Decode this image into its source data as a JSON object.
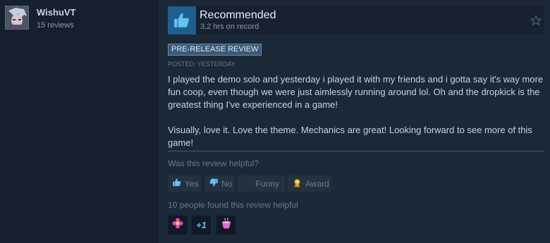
{
  "user": {
    "name": "WishuVT",
    "reviews": "15 reviews"
  },
  "review": {
    "verdict": "Recommended",
    "hours": "3,2 hrs on record",
    "badge": "PRE-RELEASE REVIEW",
    "posted": "POSTED: YESTERDAY",
    "paragraphs": [
      "I played the demo solo and yesterday i played it with my friends and i gotta say it's way more fun coop, even though we were just aimlessly running around lol. Oh and the dropkick is the greatest thing I've experienced in a game!",
      "Visually, love it. Love the theme. Mechanics are great! Looking forward to see more of this game!"
    ]
  },
  "feedback": {
    "question": "Was this review helpful?",
    "yes_label": "Yes",
    "no_label": "No",
    "funny_label": "Funny",
    "award_label": "Award",
    "found_helpful": "10 people found this review helpful"
  },
  "awards": [
    {
      "icon": "flower-award-icon"
    },
    {
      "icon": "plus-one-award-icon",
      "text": "+1"
    },
    {
      "icon": "cup-award-icon"
    }
  ],
  "colors": {
    "accent": "#1f5f8e",
    "badge_bg": "#3b5a78",
    "background": "#1b2838"
  }
}
